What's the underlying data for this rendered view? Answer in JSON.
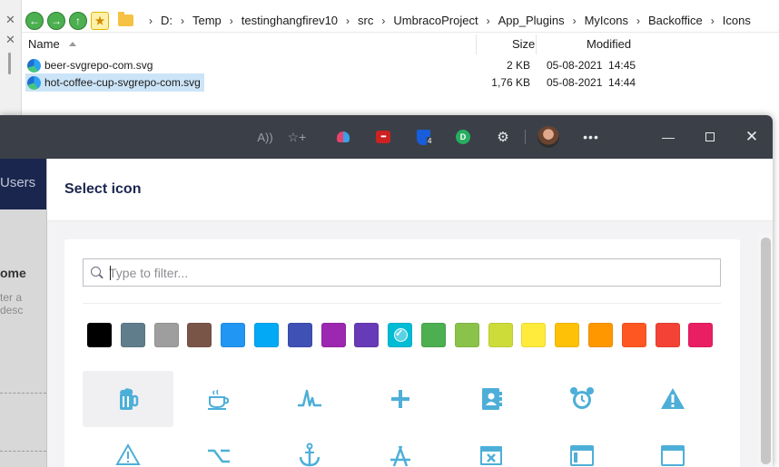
{
  "explorer": {
    "close_glyph_1": "✕",
    "close_glyph_2": "✕",
    "nav": {
      "back_icon": "back-icon",
      "forward_icon": "forward-icon",
      "up_icon": "up-icon",
      "favorite_icon": "favorites-star-icon"
    },
    "breadcrumb": [
      "D:",
      "Temp",
      "testinghangfirev10",
      "src",
      "UmbracoProject",
      "App_Plugins",
      "MyIcons",
      "Backoffice",
      "Icons"
    ],
    "columns": {
      "name": "Name",
      "size": "Size",
      "modified": "Modified"
    },
    "files": [
      {
        "name": "beer-svgrepo-com.svg",
        "size": "2 KB",
        "modified": "05-08-2021  14:45",
        "selected": false
      },
      {
        "name": "hot-coffee-cup-svgrepo-com.svg",
        "size": "1,76 KB",
        "modified": "05-08-2021  14:44",
        "selected": true
      }
    ]
  },
  "browser": {
    "toolbar_icons": [
      "read-aloud-icon",
      "add-favorite-icon",
      "extension-heart-icon",
      "lastpass-icon",
      "bitwarden-icon",
      "extension-d-icon",
      "extensions-puzzle-icon",
      "profile-avatar"
    ],
    "read_aloud_glyph": "A))",
    "add_fav_glyph": "☆+",
    "lastpass_glyph": "•••",
    "bitwarden_badge": "4",
    "ext_d_glyph": "D",
    "puzzle_glyph": "⚙",
    "more_glyph": "•••",
    "min_glyph": "—",
    "close_glyph": "✕"
  },
  "umbraco": {
    "left_users": "Users",
    "left_home": "ome",
    "left_desc": "ter a desc"
  },
  "dialog": {
    "title": "Select icon",
    "filter_placeholder": "Type to filter...",
    "colors": [
      "#000000",
      "#607d8b",
      "#9e9e9e",
      "#795548",
      "#2196f3",
      "#03a9f4",
      "#3f51b5",
      "#9c27b0",
      "#673ab7",
      "#00bcd4",
      "#4caf50",
      "#8bc34a",
      "#cddc39",
      "#ffeb3b",
      "#ffc107",
      "#ff9800",
      "#ff5722",
      "#f44336",
      "#e91e63"
    ],
    "selected_color_index": 9,
    "icon_color": "#4dafd8",
    "icons_row1": [
      "beer-icon",
      "coffee-cup-icon",
      "activity-icon",
      "add-icon",
      "address-book-icon",
      "alarm-clock-icon",
      "alert-icon"
    ],
    "icons_row2": [
      "alert-alt-icon",
      "alt-icon",
      "anchor-icon",
      "app-icon",
      "application-error-icon",
      "application-window-icon",
      "application-window-alt-icon"
    ],
    "active_icon": "beer-icon"
  }
}
